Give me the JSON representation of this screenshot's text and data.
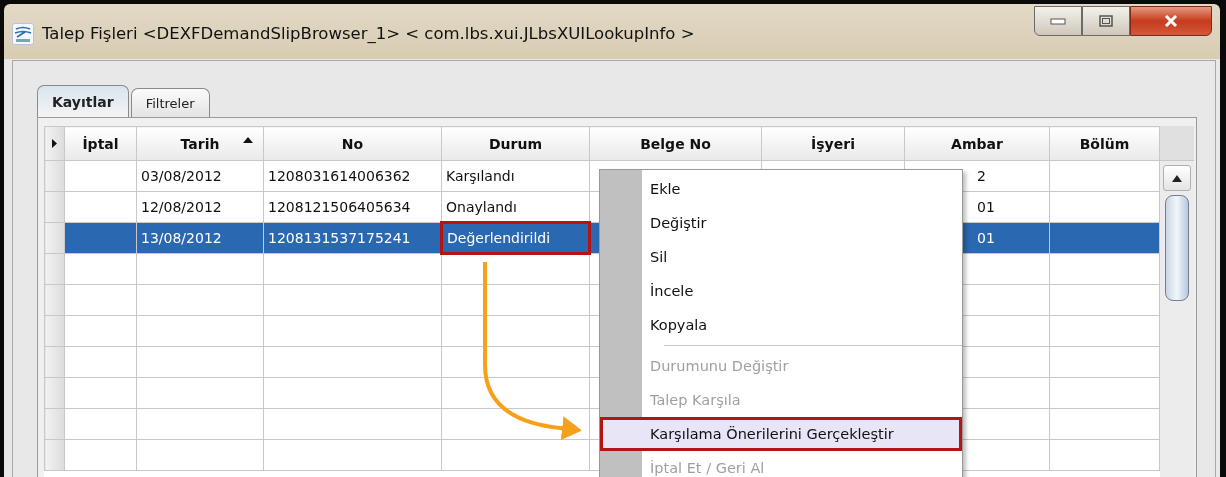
{
  "window": {
    "title": "Talep Fişleri <DEXFDemandSlipBrowser_1> < com.lbs.xui.JLbsXUILookupInfo >"
  },
  "tabs": [
    {
      "label": "Kayıtlar",
      "selected": true
    },
    {
      "label": "Filtreler",
      "selected": false
    }
  ],
  "table": {
    "columns": [
      {
        "label": "İptal",
        "sorted": false
      },
      {
        "label": "Tarih",
        "sorted": true
      },
      {
        "label": "No",
        "sorted": false
      },
      {
        "label": "Durum",
        "sorted": false
      },
      {
        "label": "Belge No",
        "sorted": false
      },
      {
        "label": "İşyeri",
        "sorted": false
      },
      {
        "label": "Ambar",
        "sorted": false
      },
      {
        "label": "Bölüm",
        "sorted": false
      }
    ],
    "rows": [
      {
        "selected": false,
        "cells": [
          {},
          {
            "text": "03/08/2012",
            "callout": false
          },
          {
            "text": "1208031614006362",
            "callout": false
          },
          {
            "text": "Karşılandı",
            "callout": false
          },
          {},
          {},
          {
            "text": "2",
            "callout": false
          },
          {}
        ]
      },
      {
        "selected": false,
        "cells": [
          {},
          {
            "text": "12/08/2012",
            "callout": false
          },
          {
            "text": "1208121506405634",
            "callout": false
          },
          {
            "text": "Onaylandı",
            "callout": false
          },
          {},
          {},
          {
            "text": "01",
            "callout": false
          },
          {}
        ]
      },
      {
        "selected": true,
        "cells": [
          {},
          {
            "text": "13/08/2012",
            "callout": false
          },
          {
            "text": "1208131537175241",
            "callout": false
          },
          {
            "text": "Değerlendirildi",
            "callout": true
          },
          {},
          {},
          {
            "text": "01",
            "callout": false
          },
          {}
        ]
      }
    ]
  },
  "context_menu": {
    "items": [
      {
        "kind": "item",
        "label": "Ekle",
        "disabled": false,
        "callout": false
      },
      {
        "kind": "item",
        "label": "Değiştir",
        "disabled": false,
        "callout": false
      },
      {
        "kind": "item",
        "label": "Sil",
        "disabled": false,
        "callout": false
      },
      {
        "kind": "item",
        "label": "İncele",
        "disabled": false,
        "callout": false
      },
      {
        "kind": "item",
        "label": "Kopyala",
        "disabled": false,
        "callout": false
      },
      {
        "kind": "separator"
      },
      {
        "kind": "item",
        "label": "Durumunu Değiştir",
        "disabled": true,
        "callout": false
      },
      {
        "kind": "item",
        "label": "Talep Karşıla",
        "disabled": true,
        "callout": false
      },
      {
        "kind": "item",
        "label": "Karşılama Önerilerini Gerçekleştir",
        "disabled": false,
        "callout": true
      },
      {
        "kind": "item",
        "label": "İptal Et / Geri Al",
        "disabled": true,
        "callout": false
      }
    ]
  }
}
